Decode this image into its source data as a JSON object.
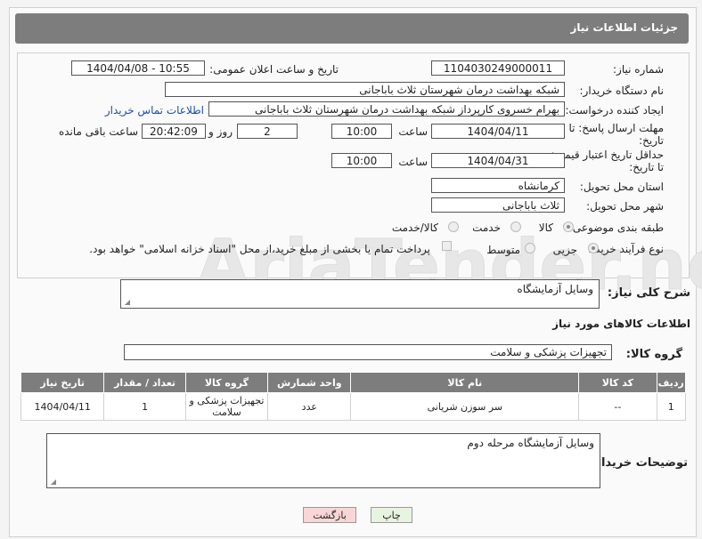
{
  "header": {
    "title": "جزئیات اطلاعات نیاز"
  },
  "form": {
    "need_number_label": "شماره نیاز:",
    "need_number": "1104030249000011",
    "announce_label": "تاریخ و ساعت اعلان عمومی:",
    "announce_value": "1404/04/08 - 10:55",
    "buyer_org_label": "نام دستگاه خریدار:",
    "buyer_org": "شبکه بهداشت درمان شهرستان ثلاث باباجانی",
    "creator_label": "ایجاد کننده درخواست:",
    "creator": "بهرام خسروی کارپرداز شبکه بهداشت درمان شهرستان ثلاث باباجانی",
    "contact_link": "اطلاعات تماس خریدار",
    "deadline_label_1": "مهلت ارسال پاسخ: تا",
    "deadline_label_2": "تاریخ:",
    "deadline_date": "1404/04/11",
    "time_label": "ساعت",
    "deadline_time": "10:00",
    "days_value": "2",
    "days_label": "روز و",
    "remaining_time": "20:42:09",
    "remaining_label": "ساعت باقی مانده",
    "price_label_1": "حداقل تاریخ اعتبار قیمت:",
    "price_label_2": "تا تاریخ:",
    "price_date": "1404/04/31",
    "price_time": "10:00",
    "province_label": "استان محل تحویل:",
    "province": "کرمانشاه",
    "city_label": "شهر محل تحویل:",
    "city": "ثلاث باباجانی",
    "category_label": "طبقه بندی موضوعی:",
    "category_options": [
      "کالا",
      "خدمت",
      "کالا/خدمت"
    ],
    "process_label": "نوع فرآیند خرید :",
    "process_options": [
      "جزیی",
      "متوسط"
    ],
    "payment_note": "پرداخت تمام یا بخشی از مبلغ خرید،از محل \"اسناد خزانه اسلامی\" خواهد بود."
  },
  "description": {
    "label": "شرح کلی نیاز:",
    "value": "وسایل آزمایشگاه"
  },
  "goods_info": {
    "title": "اطلاعات کالاهای مورد نیاز",
    "group_label": "گروه کالا:",
    "group_value": "تجهیزات پزشکی و سلامت"
  },
  "table": {
    "headers": [
      "ردیف",
      "کد کالا",
      "نام کالا",
      "واحد شمارش",
      "گروه کالا",
      "تعداد / مقدار",
      "تاریخ نیاز"
    ],
    "rows": [
      [
        "1",
        "--",
        "سر سوزن شریانی",
        "عدد",
        "تجهیزات پزشکی و سلامت",
        "1",
        "1404/04/11"
      ]
    ]
  },
  "buyer_notes": {
    "label": "توضیحات خریدار:",
    "value": "وسایل آزمایشگاه مرحله دوم"
  },
  "buttons": {
    "print": "چاپ",
    "back": "بازگشت"
  },
  "colors": {
    "header_bg": "#7d7d7d",
    "link": "#1a4fa8",
    "print_bg": "#e8f4e0",
    "back_bg": "#f9d6d6"
  },
  "watermark_text": "AriaTender.neT"
}
